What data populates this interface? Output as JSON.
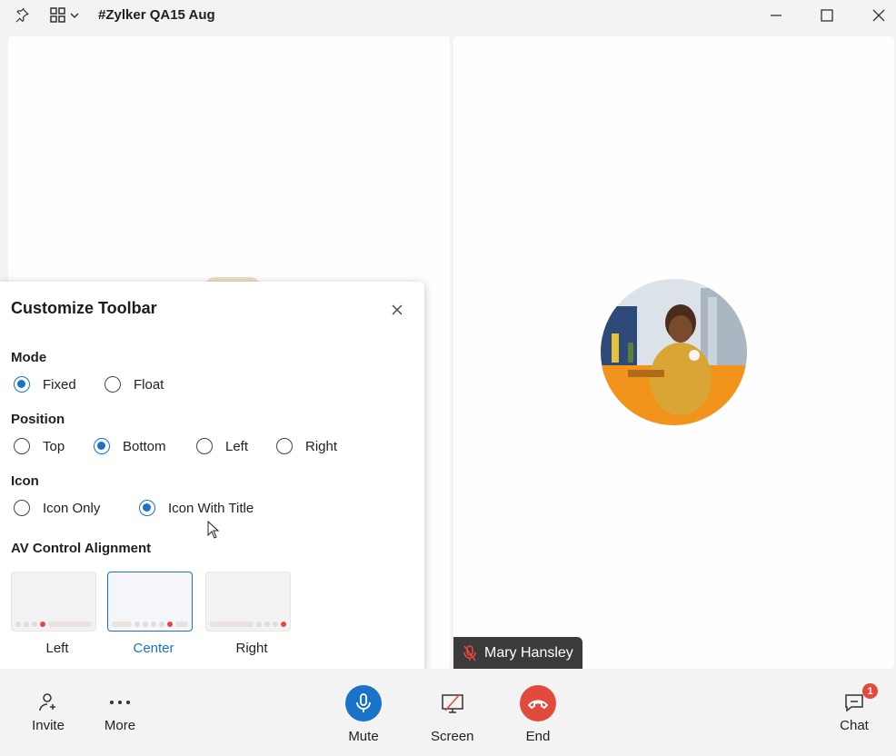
{
  "window": {
    "title": "#Zylker QA15 Aug"
  },
  "participant": {
    "name": "Mary Hansley",
    "mic_state": "muted"
  },
  "customize_toolbar": {
    "title": "Customize Toolbar",
    "mode": {
      "label": "Mode",
      "options": [
        "Fixed",
        "Float"
      ],
      "selected": "Fixed"
    },
    "position": {
      "label": "Position",
      "options": [
        "Top",
        "Bottom",
        "Left",
        "Right"
      ],
      "selected": "Bottom"
    },
    "icon": {
      "label": "Icon",
      "options": [
        "Icon Only",
        "Icon With Title"
      ],
      "selected": "Icon With Title"
    },
    "av_alignment": {
      "label": "AV Control Alignment",
      "options": [
        "Left",
        "Center",
        "Right"
      ],
      "selected": "Center"
    }
  },
  "toolbar": {
    "invite": "Invite",
    "more": "More",
    "mute": "Mute",
    "screen": "Screen",
    "end": "End",
    "chat": "Chat",
    "chat_badge": "1"
  },
  "colors": {
    "accent": "#1a73c8",
    "danger": "#e24a3b"
  }
}
